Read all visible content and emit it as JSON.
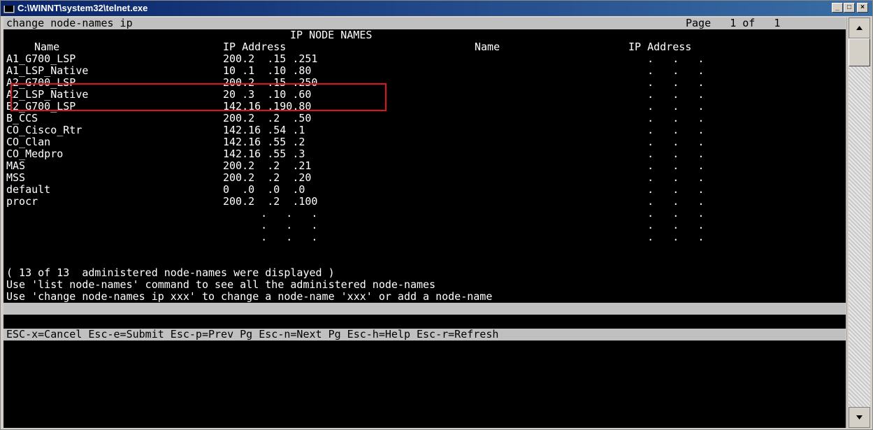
{
  "window": {
    "title": "C:\\WINNT\\system32\\telnet.exe",
    "min_glyph": "_",
    "max_glyph": "□",
    "close_glyph": "×"
  },
  "console": {
    "command": "change node-names ip",
    "page": "Page   1 of   1",
    "heading": "IP NODE NAMES",
    "col_headers": {
      "name_left": "Name",
      "ip_left": "IP Address",
      "name_right": "Name",
      "ip_right": "IP Address"
    },
    "rows": [
      {
        "name": "A1_G700_LSP",
        "ip": "200.2  .15 .251"
      },
      {
        "name": "A1_LSP_Native",
        "ip": "10 .1  .10 .80"
      },
      {
        "name": "A2_G700_LSP",
        "ip": "200.2  .15 .250"
      },
      {
        "name": "A2_LSP_Native",
        "ip": "20 .3  .10 .60"
      },
      {
        "name": "B2_G700_LSP",
        "ip": "142.16 .190.80"
      },
      {
        "name": "B_CCS",
        "ip": "200.2  .2  .50"
      },
      {
        "name": "CO_Cisco_Rtr",
        "ip": "142.16 .54 .1"
      },
      {
        "name": "CO_Clan",
        "ip": "142.16 .55 .2"
      },
      {
        "name": "CO_Medpro",
        "ip": "142.16 .55 .3"
      },
      {
        "name": "MAS",
        "ip": "200.2  .2  .21"
      },
      {
        "name": "MSS",
        "ip": "200.2  .2  .20"
      },
      {
        "name": "default",
        "ip": "0  .0  .0  .0"
      },
      {
        "name": "procr",
        "ip": "200.2  .2  .100"
      },
      {
        "name": "",
        "ip": "      .   .   ."
      },
      {
        "name": "",
        "ip": "      .   .   ."
      },
      {
        "name": "",
        "ip": "      .   .   ."
      }
    ],
    "right_dots": "   .   .   .",
    "status_lines": [
      "( 13 of 13  administered node-names were displayed )",
      "Use 'list node-names' command to see all the administered node-names",
      "Use 'change node-names ip xxx' to change a node-name 'xxx' or add a node-name"
    ],
    "footer": "ESC-x=Cancel Esc-e=Submit Esc-p=Prev Pg Esc-n=Next Pg Esc-h=Help Esc-r=Refresh"
  },
  "colors": {
    "console_bg": "#000000",
    "console_fg": "#ffffff",
    "highlight_box": "#e0141e",
    "titlebar_left": "#0a246a",
    "titlebar_right": "#3a6ea5"
  },
  "icons": {
    "app": "console-icon",
    "scroll_up": "arrow-up-icon",
    "scroll_down": "arrow-down-icon"
  }
}
